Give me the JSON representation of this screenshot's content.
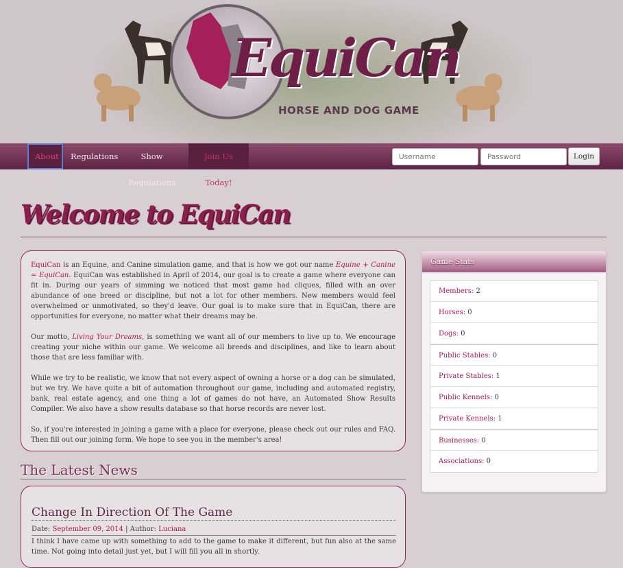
{
  "brand": {
    "name": "EquiCan",
    "tagline": "HORSE AND DOG GAME"
  },
  "nav": {
    "items": [
      {
        "label": "About"
      },
      {
        "label": "Regulations"
      },
      {
        "label": "Show Regulations"
      },
      {
        "label": "Join Us Today!"
      }
    ],
    "username_placeholder": "Username",
    "password_placeholder": "Password",
    "login_label": "Login"
  },
  "welcome": {
    "title": "Welcome to EquiCan"
  },
  "about": {
    "p1_brand": "EquiCan",
    "p1_a": " is an Equine, and Canine simulation game, and that is how we got our name ",
    "p1_formula": "Equine + Canine = EquiCan",
    "p1_b": ". EquiCan was established in April of 2014, our goal is to create a game where everyone can fit in. During our years of simming we noticed that most game had cliques, filled with an over abundance of one breed or discipline, but not a lot for other members. New members would feel overwhelmed or unmotivated, so they'd leave. Our goal is to make sure that in EquiCan, there are opportunities for everyone, no matter what their dreams may be.",
    "p2_a": "Our motto, ",
    "p2_motto": "Living Your Dreams",
    "p2_b": ", is something we want all of our members to live up to. We encourage creating your niche within our game. We welcome all breeds and disciplines, and like to learn about those that are less familiar with.",
    "p3": "While we try to be realistic, we know that not every aspect of owning a horse or a dog can be simulated, but we try. We have quite a bit of automation throughout our game, including and automated registry, bank, real estate agency, and one thing a lot of games do not have, an Automated Show Results Compiler. We also have a show results database so that horse records are never lost.",
    "p4": "So, if you're interested in joining a game with a place for everyone, please check out our rules and FAQ. Then fill out our joining form. We hope to see you in the member's area!"
  },
  "news": {
    "heading": "The Latest News",
    "post": {
      "title": "Change In Direction Of The Game",
      "date_label": "Date:",
      "date": "September 09, 2014",
      "author_label": "| Author:",
      "author": "Luciana",
      "body": "I think I have came up with something to add to the game to make it different, but fun also at the same time. Not going into detail just yet, but I will fill you all in shortly."
    }
  },
  "stats": {
    "title": "Game Stats",
    "items": [
      {
        "label": "Members:",
        "value": "2"
      },
      {
        "label": "Horses:",
        "value": "0"
      },
      {
        "label": "Dogs:",
        "value": "0"
      },
      {
        "label": "Public Stables:",
        "value": "0"
      },
      {
        "label": "Private Stables:",
        "value": "1"
      },
      {
        "label": "Public Kennels:",
        "value": "0"
      },
      {
        "label": "Private Kennels:",
        "value": "1"
      },
      {
        "label": "Businesses:",
        "value": "0"
      },
      {
        "label": "Associations:",
        "value": "0"
      }
    ]
  },
  "colors": {
    "accent": "#b0174d",
    "nav": "#6b2f50",
    "background": "#d8cfd3"
  }
}
